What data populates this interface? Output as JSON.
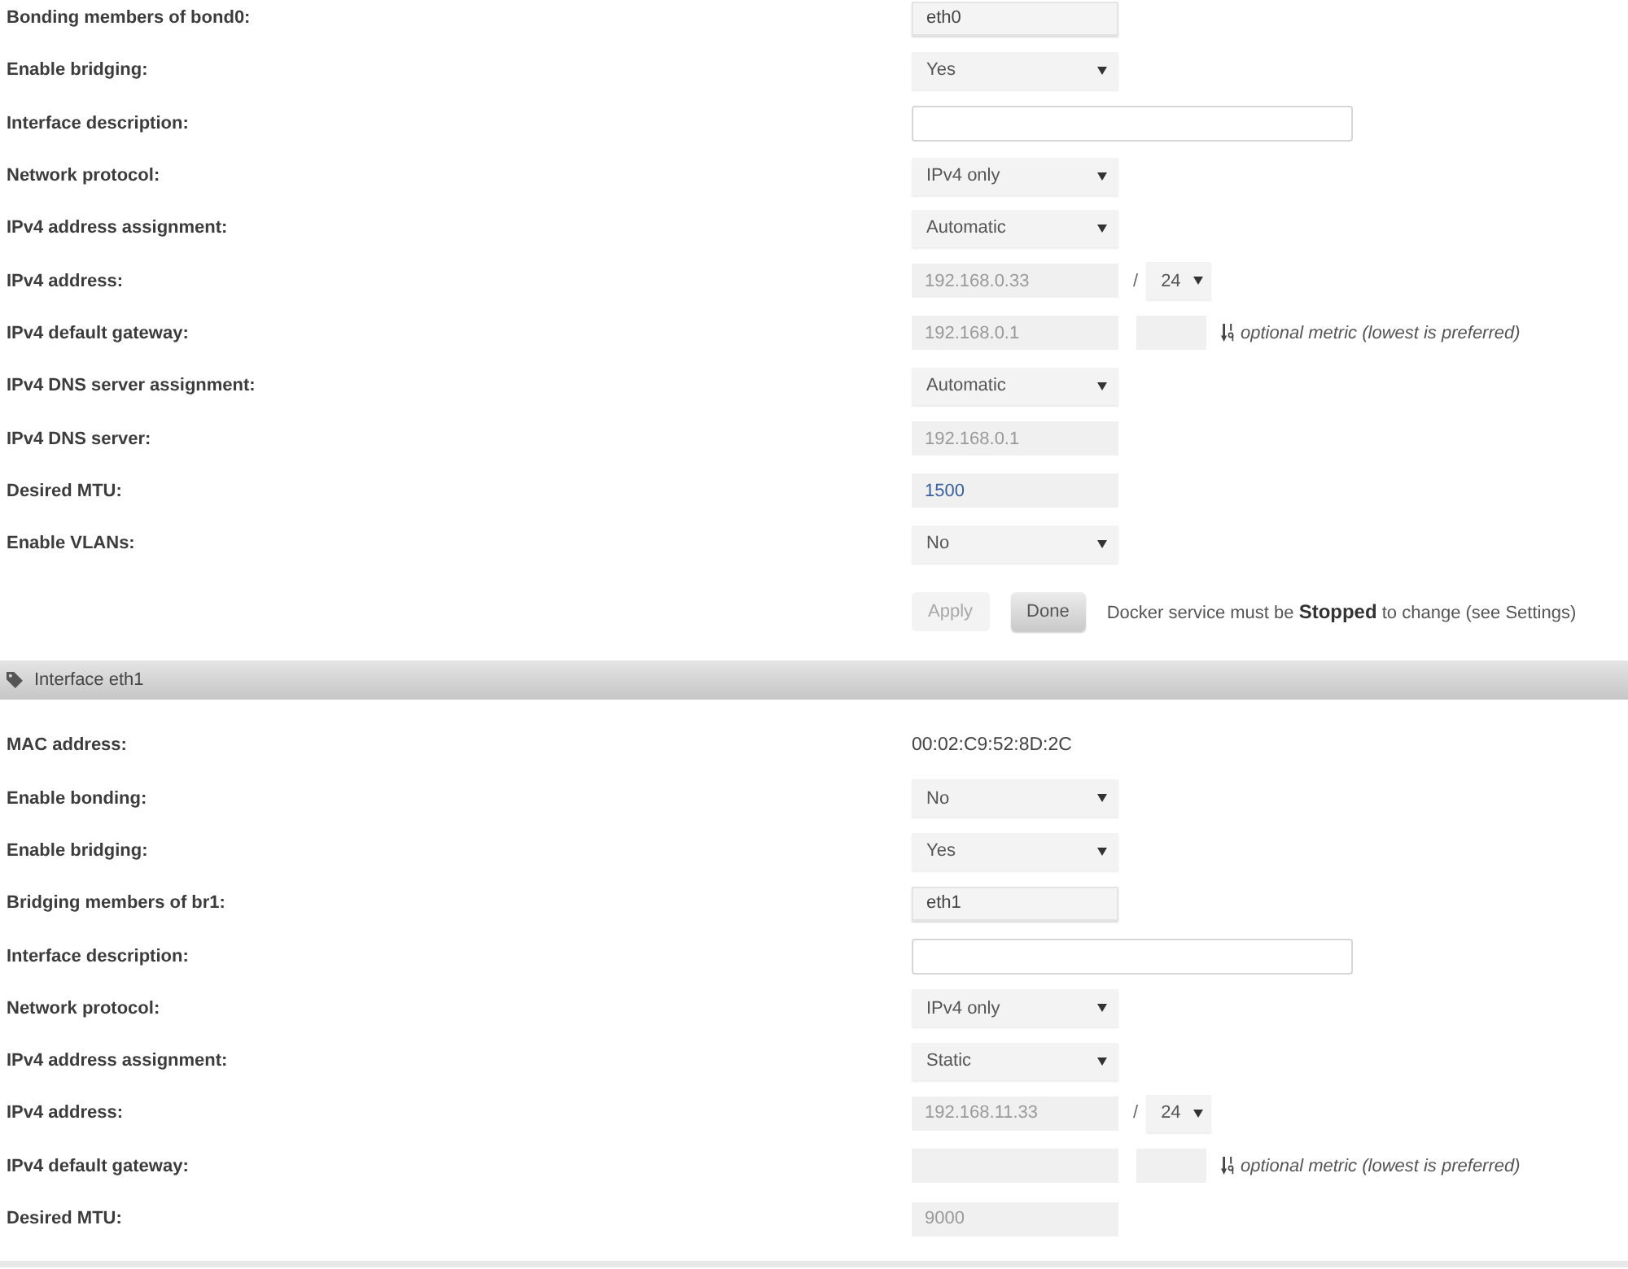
{
  "sections": [
    {
      "rows": [
        {
          "label": "Bonding members of bond0:",
          "control": {
            "kind": "input",
            "value": "eth0",
            "disabled": false
          }
        },
        {
          "label": "Enable bridging:",
          "control": {
            "kind": "select",
            "value": "Yes"
          }
        },
        {
          "label": "Interface description:",
          "control": {
            "kind": "textbox"
          }
        },
        {
          "label": "Network protocol:",
          "control": {
            "kind": "select",
            "value": "IPv4 only"
          }
        },
        {
          "label": "IPv4 address assignment:",
          "control": {
            "kind": "select",
            "value": "Automatic"
          }
        },
        {
          "label": "IPv4 address:",
          "control": {
            "kind": "address",
            "value": "192.168.0.33",
            "disabled": true,
            "separator": "/",
            "mask": "24"
          }
        },
        {
          "label": "IPv4 default gateway:",
          "control": {
            "kind": "gateway",
            "value": "192.168.0.1",
            "disabled": true,
            "hint": "optional metric (lowest is preferred)"
          }
        },
        {
          "label": "IPv4 DNS server assignment:",
          "control": {
            "kind": "select",
            "value": "Automatic"
          }
        },
        {
          "label": "IPv4 DNS server:",
          "control": {
            "kind": "input",
            "value": "192.168.0.1",
            "disabled": true
          }
        },
        {
          "label": "Desired MTU:",
          "control": {
            "kind": "number",
            "value": "1500",
            "disabled": false
          }
        },
        {
          "label": "Enable VLANs:",
          "control": {
            "kind": "select",
            "value": "No"
          }
        }
      ],
      "buttons": [
        {
          "label": "Apply",
          "disabled": true
        },
        {
          "label": "Done",
          "disabled": false
        }
      ],
      "note": "Docker service must be **Stopped** to change (see Settings)"
    },
    {
      "header": {
        "title": "Interface eth1"
      },
      "rows": [
        {
          "label": "MAC address:",
          "control": {
            "kind": "text",
            "value": "00:02:C9:52:8D:2C"
          }
        },
        {
          "label": "Enable bonding:",
          "control": {
            "kind": "select",
            "value": "No"
          }
        },
        {
          "label": "Enable bridging:",
          "control": {
            "kind": "select",
            "value": "Yes"
          }
        },
        {
          "label": "Bridging members of br1:",
          "control": {
            "kind": "input",
            "value": "eth1",
            "disabled": false
          }
        },
        {
          "label": "Interface description:",
          "control": {
            "kind": "textbox"
          }
        },
        {
          "label": "Network protocol:",
          "control": {
            "kind": "select",
            "value": "IPv4 only"
          }
        },
        {
          "label": "IPv4 address assignment:",
          "control": {
            "kind": "select",
            "value": "Static"
          }
        },
        {
          "label": "IPv4 address:",
          "control": {
            "kind": "address",
            "value": "192.168.11.33",
            "disabled": true,
            "separator": "/",
            "mask": "24"
          }
        },
        {
          "label": "IPv4 default gateway:",
          "control": {
            "kind": "gateway",
            "disabled": true,
            "hint": "optional metric (lowest is preferred)"
          }
        },
        {
          "label": "Desired MTU:",
          "control": {
            "kind": "number",
            "value": "9000",
            "disabled": true
          }
        }
      ]
    }
  ]
}
